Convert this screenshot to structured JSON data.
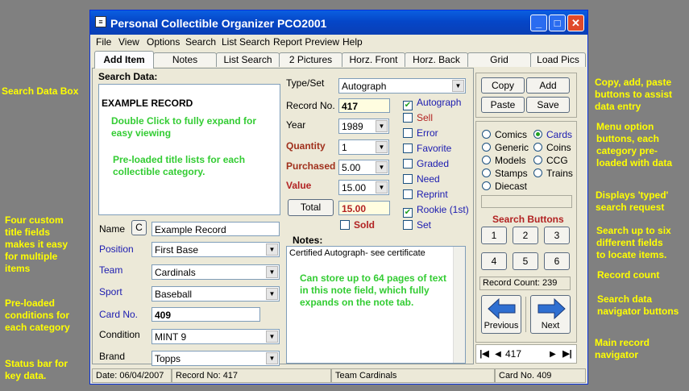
{
  "annotations": {
    "search_data_box": "Search Data Box",
    "four_custom": [
      "Four custom",
      "title fields",
      "makes it easy",
      "for multiple",
      "items"
    ],
    "preloaded": [
      "Pre-loaded",
      "conditions for",
      "each category"
    ],
    "status_bar": [
      "Status bar for",
      "key data."
    ],
    "copy_add": [
      "Copy, add, paste",
      "buttons to assist",
      "data entry"
    ],
    "menu_option": [
      "Menu option",
      "buttons, each",
      "category pre-",
      "loaded with data"
    ],
    "displays": [
      "Displays 'typed'",
      "search request"
    ],
    "search_up": [
      "Search up to six",
      "different fields",
      "to locate items."
    ],
    "record_count": "Record count",
    "search_nav": [
      "Search data",
      "navigator buttons"
    ],
    "main_nav": [
      "Main record",
      "navigator"
    ]
  },
  "window": {
    "title": "Personal Collectible Organizer PCO2001",
    "app_icon": "document-icon",
    "minimize": "_",
    "maximize": "□",
    "close": "✕"
  },
  "menu": [
    "File",
    "View",
    "Options",
    "Search",
    "List Search",
    "Report Preview",
    "Help"
  ],
  "tabs": [
    "Add Item",
    "Notes",
    "List Search",
    "2 Pictures",
    "Horz. Front",
    "Horz. Back",
    "Grid",
    "Load Pics"
  ],
  "search": {
    "label": "Search Data:",
    "title": "EXAMPLE RECORD",
    "hint1": "Double Click to fully expand for easy viewing",
    "hint2": "Pre-loaded title lists for each collectible category."
  },
  "fields": {
    "name_label": "Name",
    "name_btn": "C",
    "name_value": "Example Record",
    "position_label": "Position",
    "position_value": "First Base",
    "team_label": "Team",
    "team_value": "Cardinals",
    "sport_label": "Sport",
    "sport_value": "Baseball",
    "card_label": "Card No.",
    "card_value": "409",
    "condition_label": "Condition",
    "condition_value": "MINT  9",
    "brand_label": "Brand",
    "brand_value": "Topps"
  },
  "details": {
    "type_label": "Type/Set",
    "type_value": "Autograph",
    "record_label": "Record No.",
    "record_value": "417",
    "year_label": "Year",
    "year_value": "1989",
    "quantity_label": "Quantity",
    "quantity_value": "1",
    "purchased_label": "Purchased",
    "purchased_value": "5.00",
    "value_label": "Value",
    "value_value": "15.00",
    "total_btn": "Total",
    "total_value": "15.00",
    "sold_label": "Sold"
  },
  "checks": [
    {
      "label": "Autograph",
      "checked": true,
      "color": "blue"
    },
    {
      "label": "Sell",
      "checked": false,
      "color": "red"
    },
    {
      "label": "Error",
      "checked": false,
      "color": "blue"
    },
    {
      "label": "Favorite",
      "checked": false,
      "color": "blue"
    },
    {
      "label": "Graded",
      "checked": false,
      "color": "blue"
    },
    {
      "label": "Need",
      "checked": false,
      "color": "blue"
    },
    {
      "label": "Reprint",
      "checked": false,
      "color": "blue"
    },
    {
      "label": "Rookie (1st)",
      "checked": true,
      "color": "blue"
    },
    {
      "label": "Set",
      "checked": false,
      "color": "blue"
    }
  ],
  "notes": {
    "label": "Notes:",
    "text": "Certified Autograph- see certificate",
    "hint": "Can store up to 64 pages of text in this note field, which fully expands on the note tab."
  },
  "right": {
    "copy": "Copy",
    "add": "Add",
    "paste": "Paste",
    "save": "Save",
    "categories": [
      "Comics",
      "Cards",
      "Generic",
      "Coins",
      "Models",
      "CCG",
      "Stamps",
      "Trains",
      "Diecast"
    ],
    "selected_category": "Cards",
    "search_buttons_label": "Search Buttons",
    "search_buttons": [
      "1",
      "2",
      "3",
      "4",
      "5",
      "6"
    ],
    "record_count": "Record Count: 239",
    "previous": "Previous",
    "next": "Next",
    "nav_value": "417"
  },
  "status": {
    "date": "Date: 06/04/2007",
    "record": "Record No: 417",
    "blank": "",
    "team": "Team Cardinals",
    "card": "Card No. 409"
  },
  "colors": {
    "annotation": "#ffff00",
    "titlebar": "#0a5fe0",
    "hint_green": "#33cc33"
  }
}
